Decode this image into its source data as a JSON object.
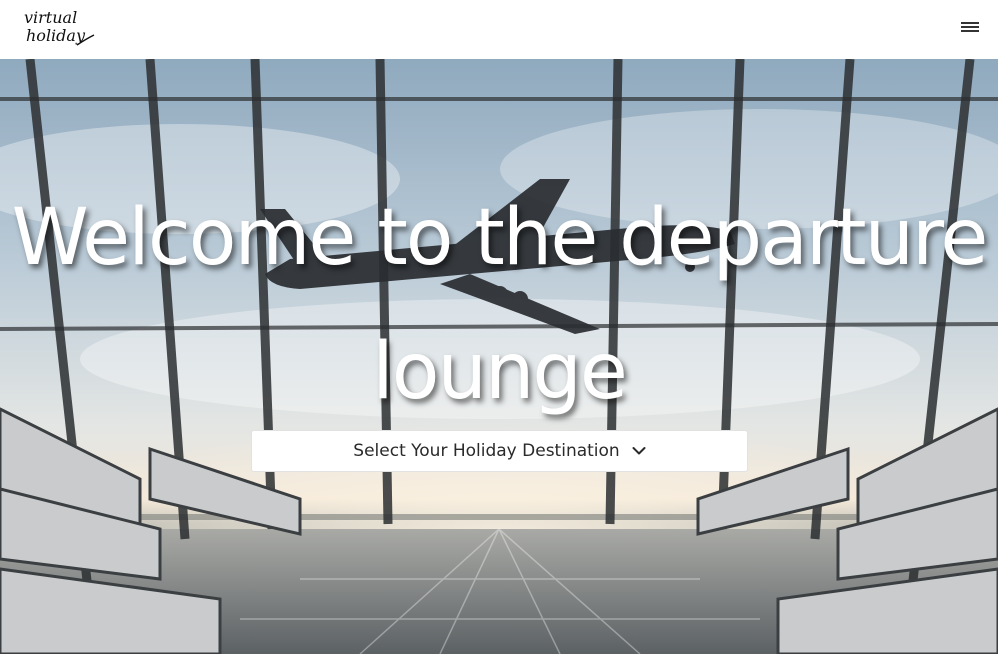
{
  "header": {
    "logo_text_line1": "virtual",
    "logo_text_line2": "holiday",
    "menu_icon": "hamburger-menu-icon"
  },
  "hero": {
    "title": "Welcome to the departure lounge",
    "select": {
      "selected_value": "Select Your Holiday Destination",
      "icon": "chevron-down-icon"
    }
  },
  "colors": {
    "header_bg": "#ffffff",
    "title_text": "#ffffff",
    "sky_top": "#9fb9cf",
    "sky_mid": "#c9d5de",
    "floor": "#7e8488"
  }
}
